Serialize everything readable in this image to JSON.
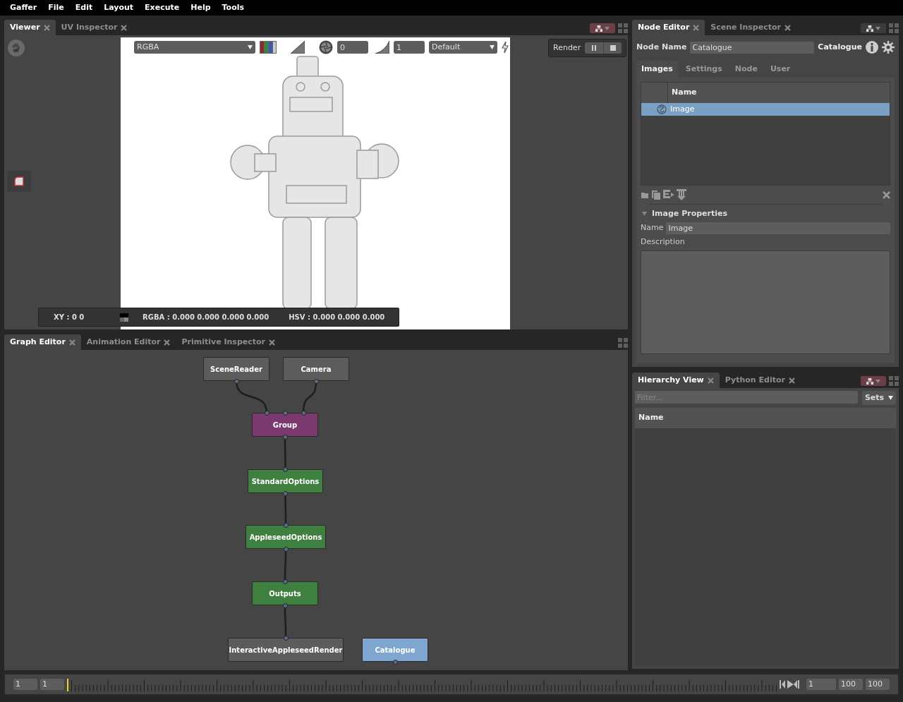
{
  "menu_bar": [
    "Gaffer",
    "File",
    "Edit",
    "Layout",
    "Execute",
    "Help",
    "Tools"
  ],
  "viewer_panel": {
    "tabs": [
      {
        "label": "Viewer",
        "selected": true
      },
      {
        "label": "UV Inspector",
        "selected": false
      }
    ],
    "channel_dropdown": "RGBA",
    "exposure": "0",
    "gamma": "1",
    "display_transform": "Default",
    "render_label": "Render",
    "pixel_info": {
      "xy": "XY : 0 0",
      "rgba": "RGBA : 0.000 0.000 0.000 0.000",
      "hsv": "HSV : 0.000 0.000 0.000"
    }
  },
  "graph_editor": {
    "tabs": [
      {
        "label": "Graph Editor",
        "selected": true
      },
      {
        "label": "Animation Editor",
        "selected": false
      },
      {
        "label": "Primitive Inspector",
        "selected": false
      }
    ],
    "nodes": [
      {
        "name": "SceneReader",
        "color": "#5c5c5c"
      },
      {
        "name": "Camera",
        "color": "#5c5c5c"
      },
      {
        "name": "Group",
        "color": "#7a3a70"
      },
      {
        "name": "StandardOptions",
        "color": "#3f7f3f"
      },
      {
        "name": "AppleseedOptions",
        "color": "#3f7f3f"
      },
      {
        "name": "Outputs",
        "color": "#3f7f3f"
      },
      {
        "name": "InteractiveAppleseedRender",
        "color": "#5c5c5c"
      },
      {
        "name": "Catalogue",
        "color": "#7ea6cf"
      }
    ]
  },
  "node_editor": {
    "tabs": [
      {
        "label": "Node Editor",
        "selected": true
      },
      {
        "label": "Scene Inspector",
        "selected": false
      }
    ],
    "node_name_label": "Node Name",
    "node_name": "Catalogue",
    "node_type": "Catalogue",
    "section_tabs": [
      {
        "label": "Images",
        "selected": true
      },
      {
        "label": "Settings",
        "selected": false
      },
      {
        "label": "Node",
        "selected": false
      },
      {
        "label": "User",
        "selected": false
      }
    ],
    "images_column": "Name",
    "images": [
      {
        "name": "Image",
        "selected": true
      }
    ],
    "section_title": "Image Properties",
    "name_label": "Name",
    "name_value": "Image",
    "description_label": "Description"
  },
  "hierarchy_view": {
    "tabs": [
      {
        "label": "Hierarchy View",
        "selected": true
      },
      {
        "label": "Python Editor",
        "selected": false
      }
    ],
    "filter_placeholder": "Filter...",
    "sets_button": "Sets",
    "column": "Name"
  },
  "timeline": {
    "start": "1",
    "current": "1",
    "frame": "1",
    "end": "100",
    "range_end": "100",
    "level": 0.0
  }
}
